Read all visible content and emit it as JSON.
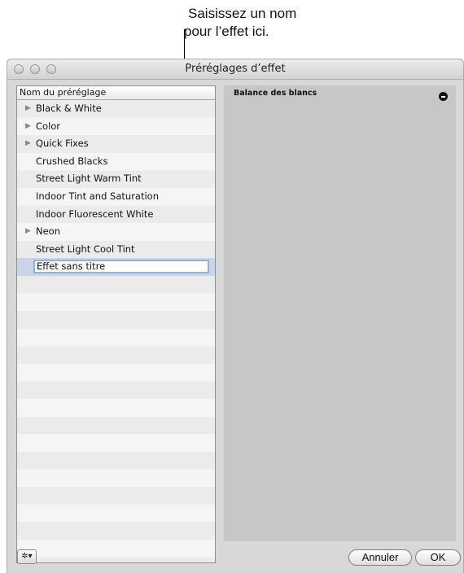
{
  "callout": {
    "line1": "Saisissez un nom",
    "line2": "pour l’effet ici."
  },
  "window": {
    "title": "Préréglages d’effet"
  },
  "list": {
    "header": "Nom du préréglage",
    "items": [
      {
        "label": "Black & White",
        "expandable": true
      },
      {
        "label": "Color",
        "expandable": true
      },
      {
        "label": "Quick Fixes",
        "expandable": true
      },
      {
        "label": "Crushed Blacks",
        "expandable": false
      },
      {
        "label": "Street Light Warm Tint",
        "expandable": false
      },
      {
        "label": "Indoor Tint and Saturation",
        "expandable": false
      },
      {
        "label": "Indoor Fluorescent White",
        "expandable": false
      },
      {
        "label": "Neon",
        "expandable": true
      },
      {
        "label": "Street Light Cool Tint",
        "expandable": false
      }
    ],
    "editing_value": "Effet sans titre"
  },
  "detail": {
    "param_label": "Balance des blancs"
  },
  "buttons": {
    "gear": "✲▾",
    "cancel": "Annuler",
    "ok": "OK"
  }
}
